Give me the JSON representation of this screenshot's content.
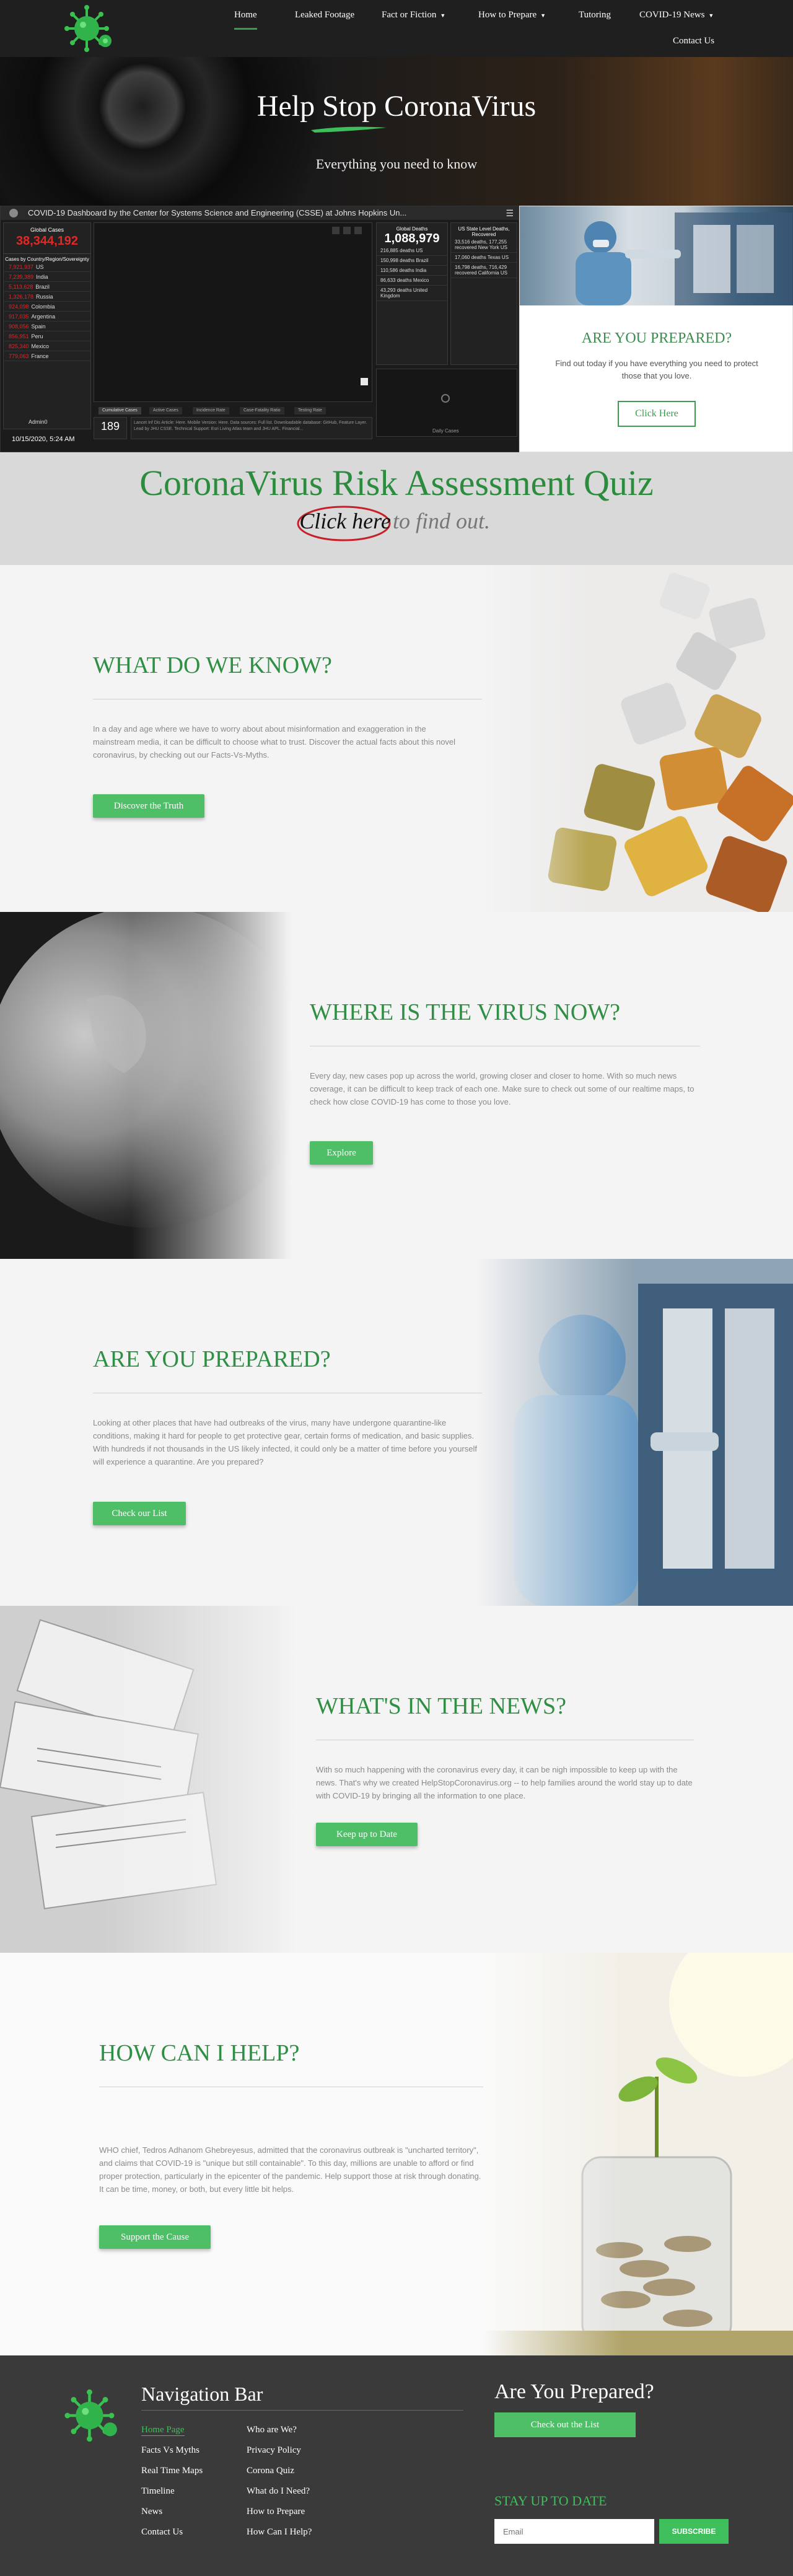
{
  "nav": {
    "items": [
      {
        "label": "Home",
        "active": true,
        "dropdown": false
      },
      {
        "label": "Leaked Footage",
        "dropdown": false
      },
      {
        "label": "Fact or Fiction",
        "dropdown": true
      },
      {
        "label": "How to Prepare",
        "dropdown": true
      },
      {
        "label": "Tutoring",
        "dropdown": false
      },
      {
        "label": "COVID-19 News",
        "dropdown": true
      },
      {
        "label": "Contact Us",
        "dropdown": false
      }
    ]
  },
  "hero": {
    "title": "Help Stop CoronaVirus",
    "subtitle": "Everything you need to know"
  },
  "dashboard": {
    "title": "COVID-19 Dashboard by the Center for Systems Science and Engineering (CSSE) at Johns Hopkins Un...",
    "global_cases_label": "Global Cases",
    "global_cases_value": "38,344,192",
    "cases_by_label": "Cases by Country/Region/Sovereignty",
    "countries": [
      {
        "count": "7,921,937",
        "name": "US"
      },
      {
        "count": "7,239,389",
        "name": "India"
      },
      {
        "count": "5,113,628",
        "name": "Brazil"
      },
      {
        "count": "1,326,178",
        "name": "Russia"
      },
      {
        "count": "924,098",
        "name": "Colombia"
      },
      {
        "count": "917,035",
        "name": "Argentina"
      },
      {
        "count": "908,056",
        "name": "Spain"
      },
      {
        "count": "856,951",
        "name": "Peru"
      },
      {
        "count": "825,340",
        "name": "Mexico"
      },
      {
        "count": "779,063",
        "name": "France"
      }
    ],
    "list_footer": "Admin0",
    "count_value": "189",
    "count_label": "countries/regions",
    "date": "10/15/2020, 5:24 AM",
    "deaths_label": "Global Deaths",
    "deaths_value": "1,088,979",
    "deaths_rows": [
      "216,885 deaths US",
      "150,998 deaths Brazil",
      "110,586 deaths India",
      "86,633 deaths Mexico",
      "43,293 deaths United Kingdom"
    ],
    "recovered_label": "US State Level Deaths, Recovered",
    "recovered_rows": [
      "33,516 deaths, 177,255 recovered New York US",
      "17,060 deaths Texas US",
      "16,798 deaths, 716,429 recovered California US"
    ],
    "map_tabs": [
      "Cumulative Cases",
      "Active Cases",
      "Incidence Rate",
      "Case-Fatality Ratio",
      "Testing Rate"
    ],
    "info_text": "Lancet Inf Dis Article: Here. Mobile Version: Here. Data sources: Full list. Downloadable database: GitHub, Feature Layer. Lead by JHU CSSE. Technical Support: Esri Living Atlas team and JHU APL. Financial...",
    "chart_footer": "Daily Cases"
  },
  "prep_card": {
    "title": "ARE YOU PREPARED?",
    "text": "Find out today if you have everything you need to protect those that you love.",
    "button": "Click Here"
  },
  "quiz": {
    "title": "CoronaVirus Risk Assessment Quiz",
    "click_here": "Click here",
    "find_out": "to find out."
  },
  "sections": {
    "know": {
      "title": "WHAT DO WE KNOW?",
      "text": "In a day and age where we have to worry about about misinformation and exaggeration in the mainstream media, it can be difficult to choose what to trust. Discover the actual facts about this novel coronavirus, by checking out our Facts-Vs-Myths.",
      "button": "Discover the Truth"
    },
    "virus": {
      "title": "WHERE IS THE VIRUS NOW?",
      "text": "Every day, new cases pop up across the world, growing closer and closer to home. With so much news coverage, it can be difficult to keep track of each one. Make sure to check out some of our realtime maps, to check how close COVID-19 has come to those you love.",
      "button": "Explore"
    },
    "prepared": {
      "title": "ARE YOU PREPARED?",
      "text": "Looking at other places that have had outbreaks of the virus, many have undergone quarantine-like conditions, making it hard for people to get protective gear, certain forms of medication, and basic supplies. With hundreds if not thousands in the US likely infected, it could only be a matter of time before you yourself will experience a quarantine. Are you prepared?",
      "button": "Check our List"
    },
    "news": {
      "title": "WHAT'S IN THE NEWS?",
      "text": "With so much happening with the coronavirus every day, it can be nigh impossible to keep up with the news. That's why we created HelpStopCoronavirus.org -- to help families around the world stay up to date with COVID-19 by bringing all the information to one place.",
      "button": "Keep up to Date"
    },
    "help": {
      "title": "HOW CAN I HELP?",
      "text": "WHO chief, Tedros Adhanom Ghebreyesus, admitted that the coronavirus outbreak is \"uncharted territory\", and claims that COVID-19 is \"unique but still containable\". To this day, millions are unable to afford or find proper protection, particularly in the epicenter of the pandemic. Help support those at risk through donating. It can be time, money, or both, but every little bit helps.",
      "button": "Support the Cause"
    }
  },
  "footer": {
    "nav_heading": "Navigation Bar",
    "col1": [
      "Home Page",
      "Facts Vs Myths",
      "Real Time Maps",
      "Timeline",
      "News",
      "Contact Us"
    ],
    "col2": [
      "Who are We?",
      "Privacy Policy",
      "Corona Quiz",
      "What do I Need?",
      "How to Prepare",
      "How Can I Help?"
    ],
    "prepared_heading": "Are You Prepared?",
    "prepared_button": "Check out the List",
    "stay_heading": "STAY UP TO DATE",
    "email_placeholder": "Email",
    "subscribe": "SUBSCRIBE"
  },
  "colors": {
    "accent_green": "#3d9a4e",
    "button_green": "#4fbf67",
    "header_bg": "#1f1f1f",
    "footer_bg": "#3a3a3a",
    "dashboard_red": "#e02828"
  }
}
